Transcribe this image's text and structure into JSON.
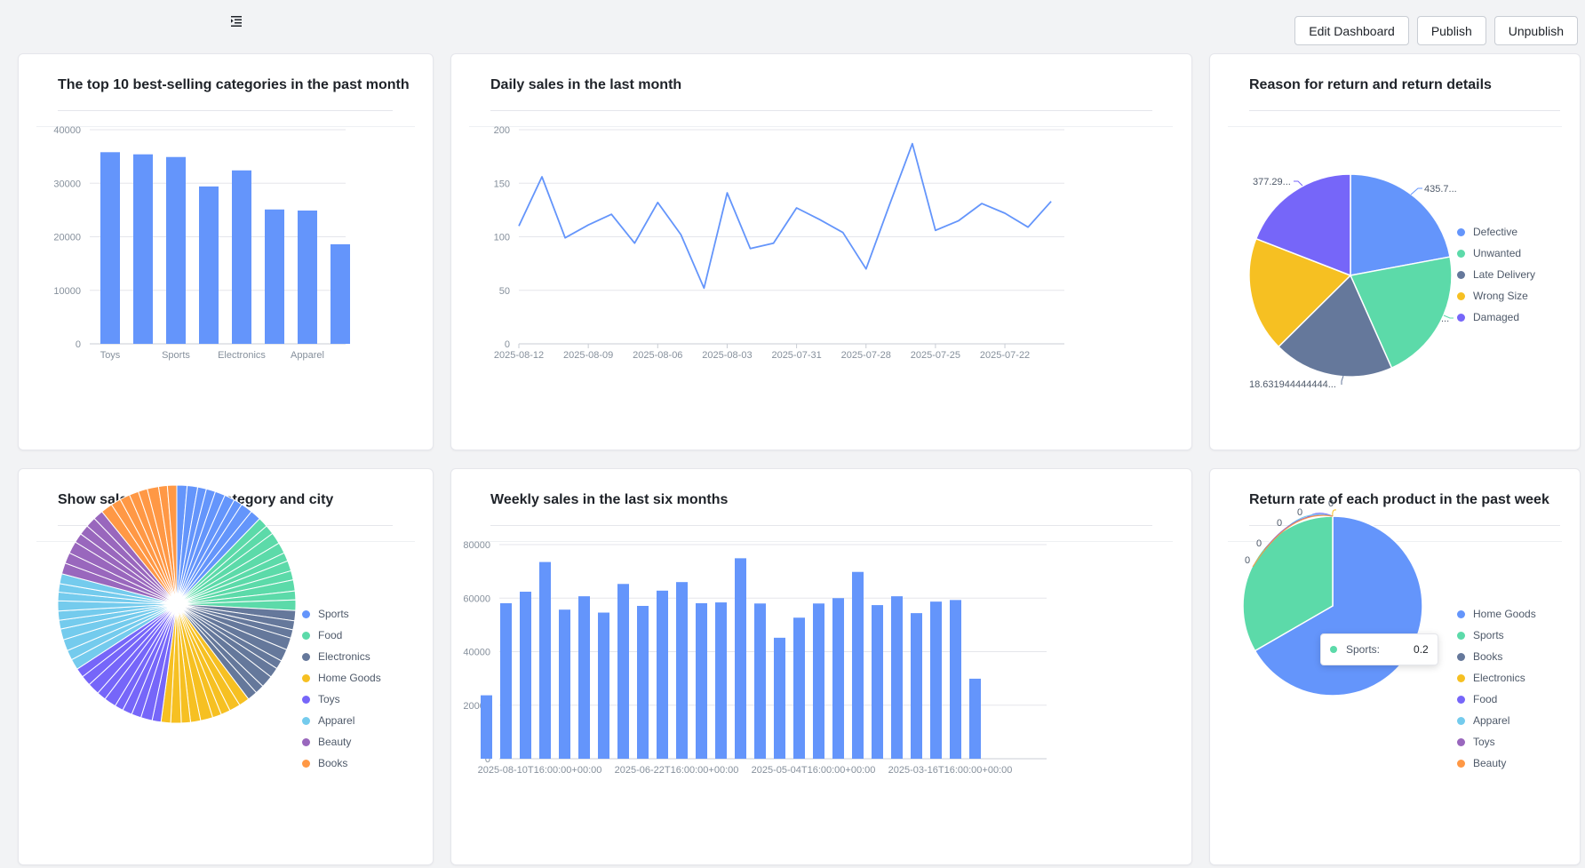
{
  "toolbar": {
    "edit_label": "Edit Dashboard",
    "publish_label": "Publish",
    "unpublish_label": "Unpublish"
  },
  "colors": {
    "blue": "#6495fb",
    "green": "#5cdaa9",
    "slate": "#65789b",
    "yellow": "#f6c022",
    "purple": "#7666f9",
    "cyan": "#74cbed",
    "violet": "#9967bd",
    "orange": "#ff9845"
  },
  "cards": {
    "c1": {
      "title": "The top 10 best-selling categories in the past month"
    },
    "c2": {
      "title": "Daily sales in the last month"
    },
    "c3": {
      "title": "Reason for return and return details"
    },
    "c4": {
      "title": "Show sales by product category and city"
    },
    "c5": {
      "title": "Weekly sales in the last six months"
    },
    "c6": {
      "title": "Return rate of each product in the past week"
    }
  },
  "chart_data": [
    {
      "id": "top_categories",
      "type": "bar",
      "title": "The top 10 best-selling categories in the past month",
      "categories": [
        "Toys",
        "",
        "Sports",
        "",
        "Electronics",
        "",
        "Apparel",
        ""
      ],
      "values": [
        35800,
        35400,
        34900,
        29400,
        32400,
        25100,
        24900,
        18600
      ],
      "yticks": [
        "0",
        "10000",
        "20000",
        "30000",
        "40000"
      ],
      "ylim": [
        0,
        40000
      ],
      "color": "#6495fb"
    },
    {
      "id": "daily_sales",
      "type": "line",
      "title": "Daily sales in the last month",
      "x": [
        "2025-08-12",
        "",
        "",
        "2025-08-09",
        "",
        "",
        "2025-08-06",
        "",
        "",
        "2025-08-03",
        "",
        "",
        "2025-07-31",
        "",
        "",
        "2025-07-28",
        "",
        "",
        "2025-07-25",
        "",
        "",
        "2025-07-22",
        "",
        ""
      ],
      "values": [
        110,
        156,
        99,
        111,
        121,
        94,
        132,
        102,
        52,
        141,
        89,
        94,
        127,
        116,
        104,
        70,
        129,
        187,
        106,
        115,
        131,
        122,
        109,
        133
      ],
      "yticks": [
        "0",
        "50",
        "100",
        "150",
        "200"
      ],
      "ylim": [
        0,
        200
      ],
      "color": "#6495fb"
    },
    {
      "id": "return_reasons",
      "type": "pie",
      "title": "Reason for return and return details",
      "slices": [
        {
          "name": "Defective",
          "value": 435.7,
          "color": "#6495fb"
        },
        {
          "name": "Unwanted",
          "value": 420,
          "color": "#5cdaa9"
        },
        {
          "name": "Late Delivery",
          "value": 380,
          "color": "#65789b"
        },
        {
          "name": "Wrong Size",
          "value": 362,
          "color": "#f6c022"
        },
        {
          "name": "Damaged",
          "value": 377.29,
          "color": "#7666f9"
        }
      ],
      "slice_labels": [
        "435.7...",
        "377.29...",
        "18.631944444444...",
        "..."
      ]
    },
    {
      "id": "sales_by_category_city",
      "type": "pie",
      "title": "Show sales by product category and city",
      "legend": [
        "Sports",
        "Food",
        "Electronics",
        "Home Goods",
        "Toys",
        "Apparel",
        "Beauty",
        "Books"
      ],
      "slice_counts": [
        9,
        10,
        10,
        9,
        10,
        10,
        7,
        8
      ],
      "colors": [
        "#6495fb",
        "#5cdaa9",
        "#65789b",
        "#f6c022",
        "#7666f9",
        "#74cbed",
        "#9967bd",
        "#ff9845"
      ]
    },
    {
      "id": "weekly_sales",
      "type": "bar",
      "title": "Weekly sales in the last six months",
      "x": [
        "2025-08-10T16:00:00+00:00",
        "",
        "",
        "",
        "",
        "",
        "",
        "2025-06-22T16:00:00+00:00",
        "",
        "",
        "",
        "",
        "",
        "",
        "2025-05-04T16:00:00+00:00",
        "",
        "",
        "",
        "",
        "",
        "",
        "2025-03-16T16:00:00+00:00",
        "",
        "",
        "",
        "",
        ""
      ],
      "values": [
        23700,
        58100,
        62400,
        73500,
        55700,
        60700,
        54600,
        65300,
        57100,
        62800,
        66000,
        58100,
        58400,
        74900,
        58000,
        45200,
        52700,
        58000,
        60000,
        69800,
        57400,
        60700,
        54400,
        58700,
        59300,
        29900
      ],
      "yticks": [
        "0",
        "20000",
        "40000",
        "60000",
        "80000"
      ],
      "ylim": [
        0,
        80000
      ],
      "color": "#6495fb"
    },
    {
      "id": "return_rate",
      "type": "pie",
      "title": "Return rate of each product in the past week",
      "legend": [
        "Home Goods",
        "Sports",
        "Books",
        "Electronics",
        "Food",
        "Apparel",
        "Toys",
        "Beauty"
      ],
      "colors": [
        "#6495fb",
        "#5cdaa9",
        "#65789b",
        "#f6c022",
        "#7666f9",
        "#74cbed",
        "#9967bd",
        "#ff9845"
      ],
      "values": [
        0.4,
        0.2,
        0,
        0,
        0,
        0,
        0,
        0
      ],
      "zero_labels": [
        "0",
        "0",
        "0",
        "0",
        "0"
      ],
      "tooltip": {
        "name": "Sports:",
        "value": "0.2"
      },
      "other_label": "..."
    }
  ]
}
